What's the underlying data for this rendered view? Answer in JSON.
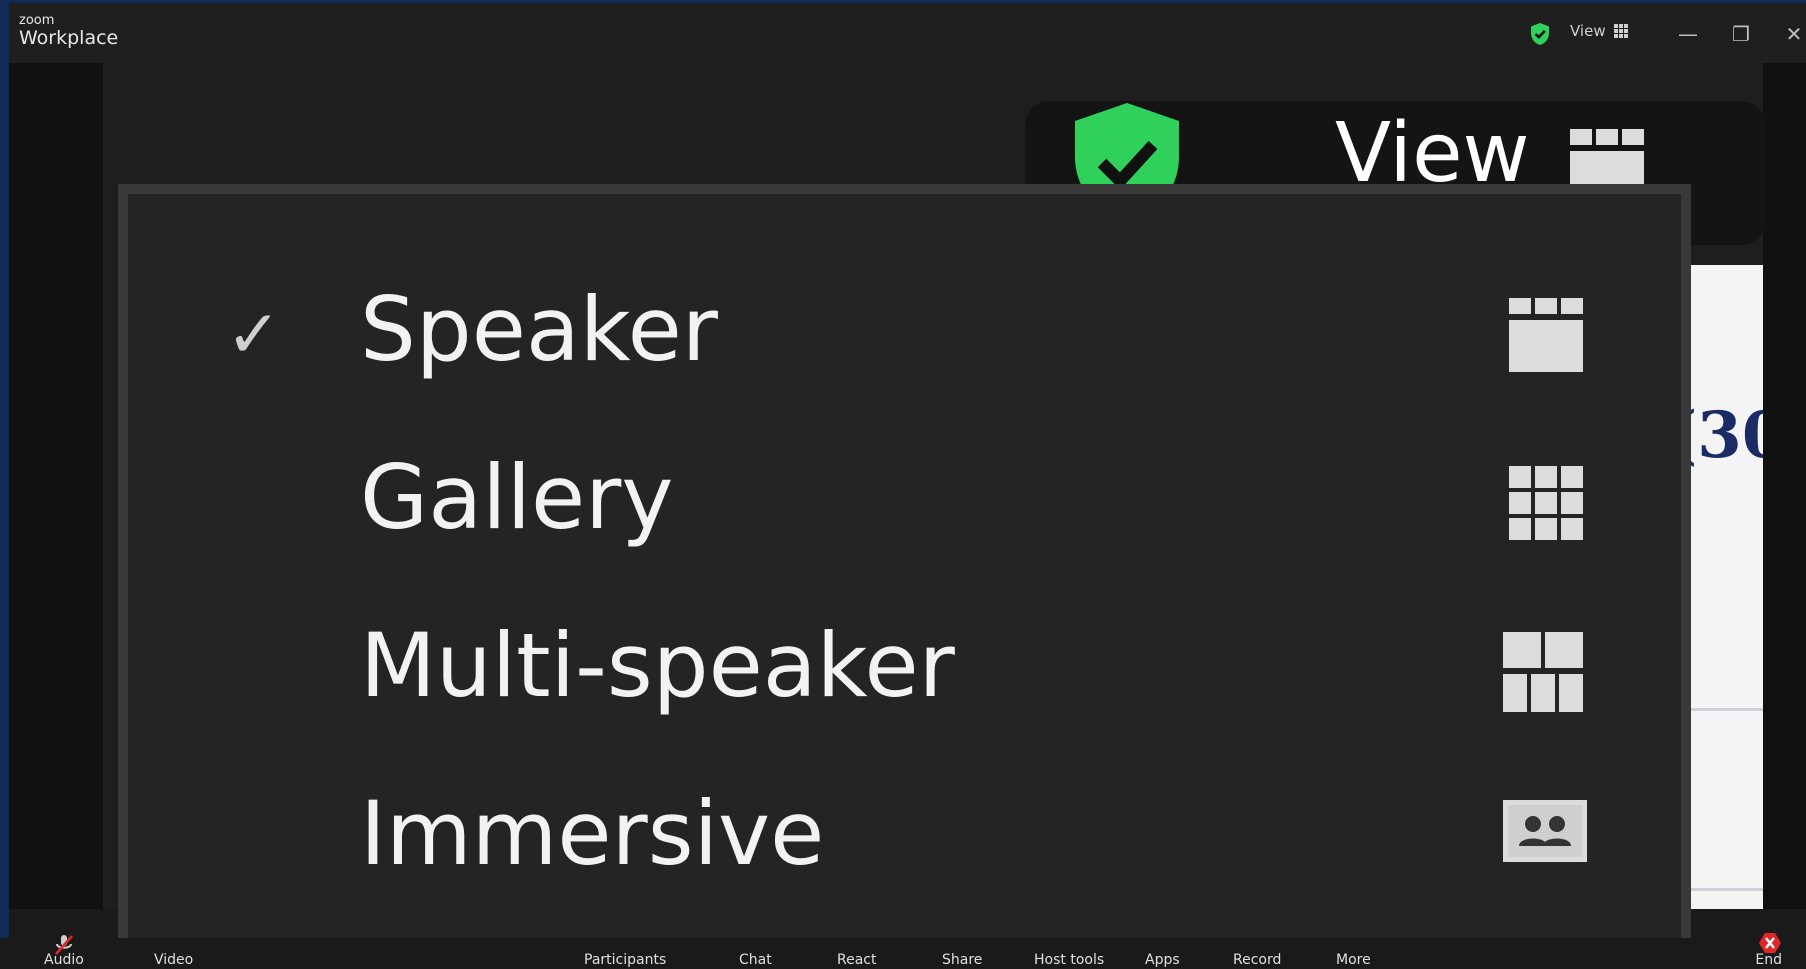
{
  "app": {
    "logo_line1": "zoom",
    "logo_line2": "Workplace"
  },
  "titlebar": {
    "view_label": "View",
    "minimize_glyph": "—",
    "restore_glyph": "❐",
    "close_glyph": "✕"
  },
  "view_button": {
    "label": "View"
  },
  "view_menu": {
    "items": [
      {
        "label": "Speaker",
        "selected": true,
        "check": "✓",
        "icon": "speaker-view-icon"
      },
      {
        "label": "Gallery",
        "selected": false,
        "check": "",
        "icon": "gallery-view-icon"
      },
      {
        "label": "Multi-speaker",
        "selected": false,
        "check": "",
        "icon": "multi-speaker-view-icon"
      },
      {
        "label": "Immersive",
        "selected": false,
        "check": "",
        "icon": "immersive-view-icon"
      }
    ]
  },
  "shared_content": {
    "text": "(30"
  },
  "toolbar": {
    "audio": "Audio",
    "video": "Video",
    "participants": "Participants",
    "chat": "Chat",
    "react": "React",
    "share": "Share",
    "host_tools": "Host tools",
    "apps": "Apps",
    "record": "Record",
    "more": "More",
    "end": "End"
  },
  "colors": {
    "accent_green": "#2fd15b",
    "background_blue": "#0f2a55",
    "menu_bg": "#242424",
    "end_red": "#e02828"
  }
}
